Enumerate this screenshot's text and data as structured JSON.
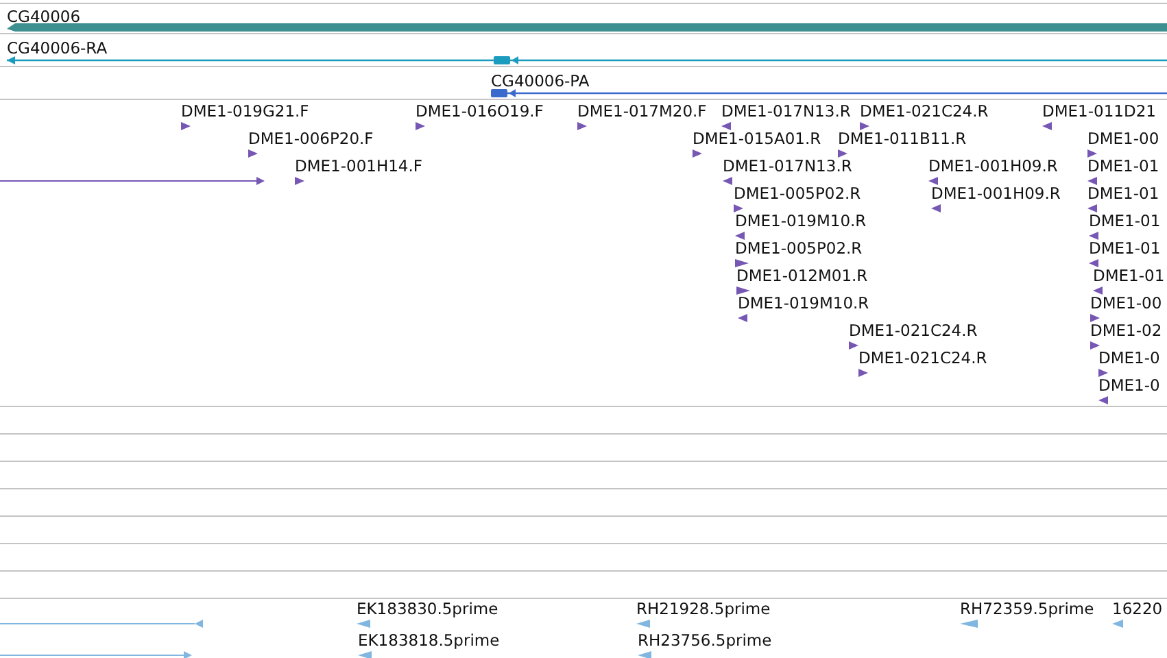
{
  "tracks": [
    {
      "kind": "gene",
      "features": [
        {
          "label": "CG40006",
          "reverse": true
        }
      ]
    },
    {
      "kind": "transcript",
      "features": [
        {
          "label": "CG40006-RA",
          "reverse": true
        }
      ]
    },
    {
      "kind": "transcript",
      "features": [
        {
          "label": "CG40006-PA",
          "reverse": true
        }
      ]
    },
    {
      "kind": "clone_ends",
      "features": [
        {
          "label": "DME1-019G21.F",
          "reverse": false
        },
        {
          "label": "DME1-016O19.F",
          "reverse": false
        },
        {
          "label": "DME1-017M20.F",
          "reverse": false
        },
        {
          "label": "DME1-017N13.R",
          "reverse": true
        },
        {
          "label": "DME1-021C24.R",
          "reverse": false
        },
        {
          "label": "DME1-011D21",
          "reverse": true
        },
        {
          "label": "DME1-006P20.F",
          "reverse": false
        },
        {
          "label": "DME1-015A01.R",
          "reverse": false
        },
        {
          "label": "DME1-011B11.R",
          "reverse": false
        },
        {
          "label": "DME1-00",
          "reverse": false
        },
        {
          "reverse": false
        },
        {
          "label": "DME1-001H14.F",
          "reverse": false
        },
        {
          "label": "DME1-017N13.R",
          "reverse": true
        },
        {
          "label": "DME1-001H09.R",
          "reverse": true
        },
        {
          "label": "DME1-01",
          "reverse": true
        },
        {
          "label": "DME1-005P02.R",
          "reverse": false
        },
        {
          "label": "DME1-001H09.R",
          "reverse": true
        },
        {
          "label": "DME1-01",
          "reverse": true
        },
        {
          "label": "DME1-019M10.R",
          "reverse": true
        },
        {
          "label": "DME1-01",
          "reverse": true
        },
        {
          "label": "DME1-005P02.R",
          "reverse": false
        },
        {
          "label": "DME1-01",
          "reverse": true
        },
        {
          "label": "DME1-012M01.R",
          "reverse": false
        },
        {
          "label": "DME1-01",
          "reverse": true
        },
        {
          "label": "DME1-019M10.R",
          "reverse": true
        },
        {
          "label": "DME1-00",
          "reverse": false
        },
        {
          "label": "DME1-021C24.R",
          "reverse": false
        },
        {
          "label": "DME1-02",
          "reverse": false
        },
        {
          "label": "DME1-021C24.R",
          "reverse": false
        },
        {
          "label": "DME1-0",
          "reverse": false
        },
        {
          "label": "DME1-0",
          "reverse": true
        }
      ]
    },
    {
      "kind": "empty"
    },
    {
      "kind": "empty"
    },
    {
      "kind": "empty"
    },
    {
      "kind": "empty"
    },
    {
      "kind": "empty"
    },
    {
      "kind": "empty"
    },
    {
      "kind": "empty"
    },
    {
      "kind": "est",
      "features": [
        {
          "reverse": true
        },
        {
          "label": "EK183830.5prime",
          "reverse": true
        },
        {
          "label": "RH21928.5prime",
          "reverse": true
        },
        {
          "label": "RH72359.5prime",
          "reverse": true
        },
        {
          "label": "16220",
          "reverse": true
        },
        {
          "reverse": false
        },
        {
          "label": "EK183818.5prime",
          "reverse": true
        },
        {
          "label": "RH23756.5prime",
          "reverse": true
        }
      ]
    }
  ]
}
